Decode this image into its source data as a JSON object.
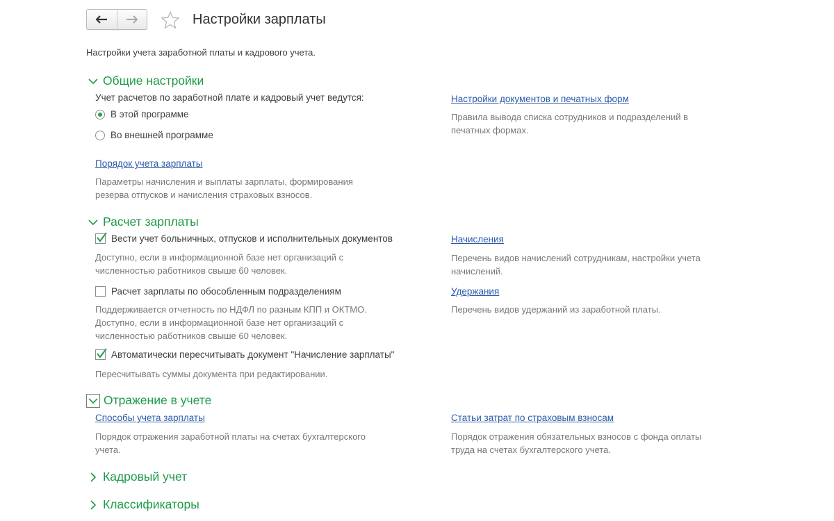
{
  "header": {
    "title": "Настройки зарплаты",
    "back_icon": "arrow-left-icon",
    "forward_icon": "arrow-right-icon",
    "favorite_icon": "star-icon"
  },
  "intro": "Настройки учета заработной платы и кадрового учета.",
  "colors": {
    "section": "#1e9a4a",
    "link": "#2b5aa8",
    "description": "#777777",
    "check": "#2d9e50"
  },
  "sections": {
    "general": {
      "title": "Общие настройки",
      "question": "Учет расчетов по заработной плате и кадровый учет ведутся:",
      "options": [
        {
          "label": "В этой программе",
          "selected": true
        },
        {
          "label": "Во внешней программе",
          "selected": false
        }
      ],
      "link_order": "Порядок учета зарплаты",
      "desc_order": [
        "Параметры начисления и выплаты зарплаты, формирования",
        "резерва отпусков и начисления страховых взносов."
      ],
      "link_docs": "Настройки документов и печатных форм",
      "desc_docs": [
        "Правила вывода списка сотрудников и подразделений в",
        "печатных формах."
      ]
    },
    "payroll": {
      "title": "Расчет зарплаты",
      "checks": [
        {
          "label": "Вести учет больничных, отпусков и исполнительных документов",
          "checked": true,
          "desc": [
            "Доступно, если в информационной базе нет организаций с",
            "численностью работников свыше 60 человек."
          ]
        },
        {
          "label": "Расчет зарплаты по обособленным подразделениям",
          "checked": false,
          "desc": [
            "Поддерживается отчетность по НДФЛ по разным КПП и ОКТМО.",
            "Доступно, если в информационной базе нет организаций с",
            "численностью работников свыше 60 человек."
          ]
        },
        {
          "label": "Автоматически пересчитывать документ \"Начисление зарплаты\"",
          "checked": true,
          "desc": [
            "Пересчитывать суммы документа при редактировании."
          ]
        }
      ],
      "link_accruals": "Начисления",
      "desc_accruals": [
        "Перечень видов начислений сотрудникам, настройки учета",
        "начислений."
      ],
      "link_deductions": "Удержания",
      "desc_deductions": [
        "Перечень видов удержаний из заработной платы."
      ]
    },
    "accounting": {
      "title": "Отражение в учете",
      "link_methods": "Способы учета зарплаты",
      "desc_methods": [
        "Порядок отражения заработной платы на счетах бухгалтерского",
        "учета."
      ],
      "link_cost_items": "Статьи затрат по страховым взносам",
      "desc_cost_items": [
        "Порядок отражения обязательных взносов с фонда оплаты",
        "труда на счетах бухгалтерского учета."
      ]
    },
    "hr": {
      "title": "Кадровый учет"
    },
    "classifiers": {
      "title": "Классификаторы"
    }
  }
}
